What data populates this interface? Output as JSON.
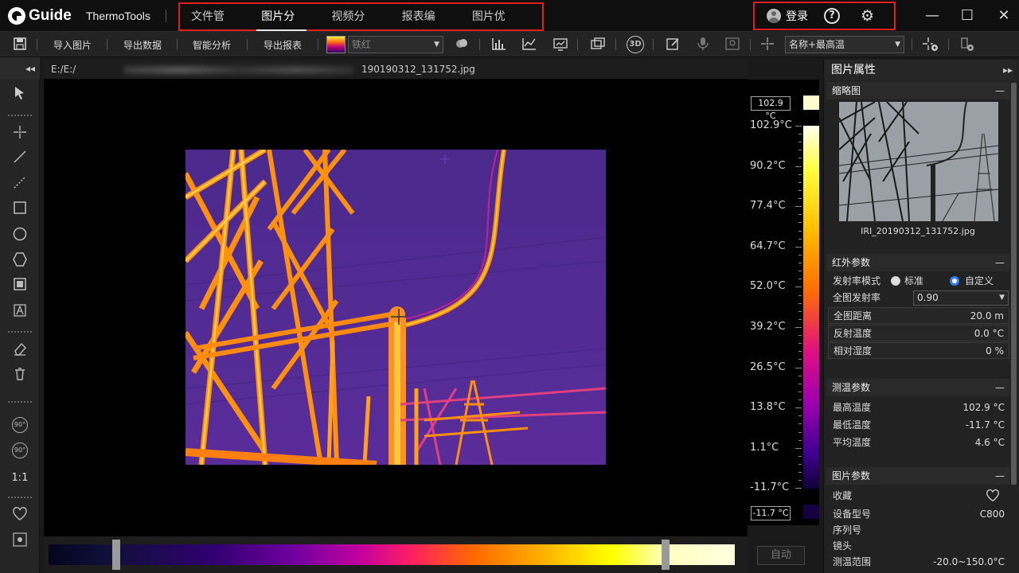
{
  "app": {
    "logo_text": "Guide",
    "name": "ThermoTools"
  },
  "nav": {
    "tabs": [
      {
        "label": "文件管理"
      },
      {
        "label": "图片分析"
      },
      {
        "label": "视频分析"
      },
      {
        "label": "报表编辑"
      },
      {
        "label": "图片优化"
      }
    ],
    "active": "图片分析"
  },
  "header_right": {
    "login_label": "登录",
    "help_glyph": "?",
    "gear_glyph": "⚙"
  },
  "window_controls": {
    "minimize": "—",
    "maximize": "☐",
    "close": "✕"
  },
  "toolbar": {
    "import_image": "导入图片",
    "export_data": "导出数据",
    "smart_analysis": "智能分析",
    "export_report": "导出报表",
    "palette_value": "铁红",
    "label_mode_value": "名称+最高温",
    "three_d_label": "3D"
  },
  "left_tools": {
    "rotate_ccw_label": "90°",
    "rotate_cw_label": "90°",
    "ratio_label": "1:1"
  },
  "canvas": {
    "path_prefix": "E:/E:/",
    "file_name": "190190312_131752.jpg"
  },
  "temperature_scale": {
    "max_box": "102.9 °C",
    "min_box": "-11.7 °C",
    "labels": [
      "102.9°C",
      "90.2°C",
      "77.4°C",
      "64.7°C",
      "52.0°C",
      "39.2°C",
      "26.5°C",
      "13.8°C",
      "1.1°C",
      "-11.7°C"
    ],
    "auto_label": "自动"
  },
  "right_panel": {
    "title": "图片属性",
    "collapse_glyph": "▸▸",
    "thumbnail": {
      "section_title": "缩略图",
      "file_name": "IRI_20190312_131752.jpg"
    },
    "ir_params": {
      "section_title": "红外参数",
      "emissivity_mode_label": "发射率模式",
      "option_standard": "标准",
      "option_custom": "自定义",
      "selected_option": "自定义",
      "global_emissivity_label": "全图发射率",
      "global_emissivity_value": "0.90",
      "global_distance_label": "全图距离",
      "global_distance_value": "20.0 m",
      "reflected_temp_label": "反射温度",
      "reflected_temp_value": "0.0 °C",
      "humidity_label": "相对湿度",
      "humidity_value": "0 %"
    },
    "measure_params": {
      "section_title": "测温参数",
      "max_label": "最高温度",
      "max_value": "102.9 °C",
      "min_label": "最低温度",
      "min_value": "-11.7 °C",
      "avg_label": "平均温度",
      "avg_value": "4.6 °C"
    },
    "image_params": {
      "section_title": "图片参数",
      "favorite_label": "收藏",
      "device_model_label": "设备型号",
      "device_model_value": "C800",
      "serial_label": "序列号",
      "lens_label": "镜头",
      "range_label": "测温范围",
      "range_value": "-20.0~150.0°C"
    }
  },
  "colors": {
    "highlight_box": "#e02020",
    "accent_blue": "#2f7cf6"
  }
}
